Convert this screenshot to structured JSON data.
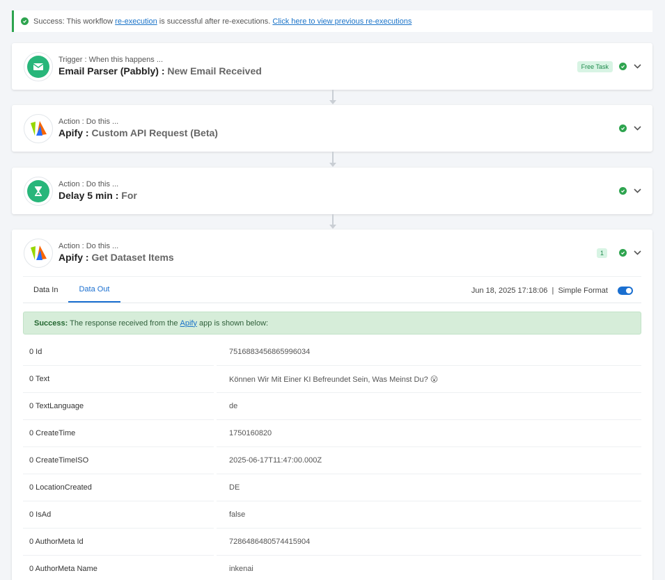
{
  "banner": {
    "prefix": "Success: This workflow ",
    "link1": "re-execution",
    "middle": " is successful after re-executions. ",
    "link2": "Click here to view previous re-executions"
  },
  "steps": [
    {
      "type": "Trigger : When this happens ...",
      "app": "Email Parser (Pabbly) :",
      "event": "New Email Received",
      "badge": "Free Task",
      "icon": "email-parser-icon"
    },
    {
      "type": "Action : Do this ...",
      "app": "Apify :",
      "event": "Custom API Request (Beta)",
      "icon": "apify-icon"
    },
    {
      "type": "Action : Do this ...",
      "app": "Delay 5 min :",
      "event": "For",
      "icon": "hourglass-icon"
    },
    {
      "type": "Action : Do this ...",
      "app": "Apify :",
      "event": "Get Dataset Items",
      "badge": "1",
      "icon": "apify-icon"
    }
  ],
  "detail": {
    "tabs": [
      "Data In",
      "Data Out"
    ],
    "timestamp": "Jun 18, 2025 17:18:06",
    "separator": "|",
    "format_label": "Simple Format",
    "format_on": true,
    "success": {
      "bold": "Success:",
      "text1": " The response received from the ",
      "link": "Apify",
      "text2": " app is shown below:"
    },
    "rows": [
      {
        "k": "0 Id",
        "v": "7516883456865996034"
      },
      {
        "k": "0 Text",
        "v": "Können Wir Mit Einer KI Befreundet Sein, Was Meinst Du? 😮"
      },
      {
        "k": "0 TextLanguage",
        "v": "de"
      },
      {
        "k": "0 CreateTime",
        "v": "1750160820"
      },
      {
        "k": "0 CreateTimeISO",
        "v": "2025-06-17T11:47:00.000Z"
      },
      {
        "k": "0 LocationCreated",
        "v": "DE"
      },
      {
        "k": "0 IsAd",
        "v": "false"
      },
      {
        "k": "0 AuthorMeta Id",
        "v": "7286486480574415904"
      },
      {
        "k": "0 AuthorMeta Name",
        "v": "inkenai"
      }
    ]
  },
  "colors": {
    "success": "#2ea44f",
    "accent": "#1a6fd0",
    "apify_green": "#97d700",
    "apify_orange": "#f86606",
    "apify_blue": "#246dff"
  }
}
